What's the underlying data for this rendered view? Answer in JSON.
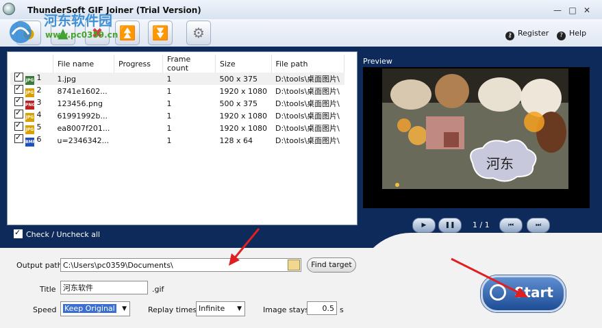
{
  "window": {
    "title": "ThunderSoft GIF Joiner (Trial Version)",
    "controls": {
      "minimize": "—",
      "maximize": "□",
      "close": "✕"
    }
  },
  "watermark": {
    "text": "河东软件园",
    "url": "www.pc0359.cn"
  },
  "toplinks": {
    "register": "Register",
    "help": "Help"
  },
  "table": {
    "headers": [
      "File name",
      "Progress",
      "Frame count",
      "Size",
      "File path"
    ],
    "rows": [
      {
        "index": "1",
        "type": "JPG",
        "color": "#3a7a3a",
        "name": "1.jpg",
        "progress": "",
        "frames": "1",
        "size": "500 x 375",
        "path": "D:\\tools\\桌面图片\\"
      },
      {
        "index": "2",
        "type": "JPG",
        "color": "#d8a000",
        "name": "8741e1602...",
        "progress": "",
        "frames": "1",
        "size": "1920 x 1080",
        "path": "D:\\tools\\桌面图片\\"
      },
      {
        "index": "3",
        "type": "PNG",
        "color": "#c02020",
        "name": "123456.png",
        "progress": "",
        "frames": "1",
        "size": "500 x 375",
        "path": "D:\\tools\\桌面图片\\"
      },
      {
        "index": "4",
        "type": "JPG",
        "color": "#d8a000",
        "name": "61991992b...",
        "progress": "",
        "frames": "1",
        "size": "1920 x 1080",
        "path": "D:\\tools\\桌面图片\\"
      },
      {
        "index": "5",
        "type": "JPG",
        "color": "#d8a000",
        "name": "ea8007f201...",
        "progress": "",
        "frames": "1",
        "size": "1920 x 1080",
        "path": "D:\\tools\\桌面图片\\"
      },
      {
        "index": "6",
        "type": "BMP",
        "color": "#2050c0",
        "name": "u=2346342...",
        "progress": "",
        "frames": "1",
        "size": "128 x 64",
        "path": "D:\\tools\\桌面图片\\"
      }
    ]
  },
  "check_all": "Check / Uncheck all",
  "preview": {
    "label": "Preview",
    "bubble_text": "河东",
    "page": "1 / 1"
  },
  "output": {
    "path_label": "Output path",
    "path_value": "C:\\Users\\pc0359\\Documents\\",
    "find_target": "Find target",
    "title_label": "Title",
    "title_value": "河东软件",
    "title_ext": ".gif",
    "speed_label": "Speed",
    "speed_value": "Keep Original",
    "replay_label": "Replay times",
    "replay_value": "Infinite",
    "stays_label": "Image stays",
    "stays_value": "0.5",
    "stays_unit": "s"
  },
  "start_label": "Start"
}
